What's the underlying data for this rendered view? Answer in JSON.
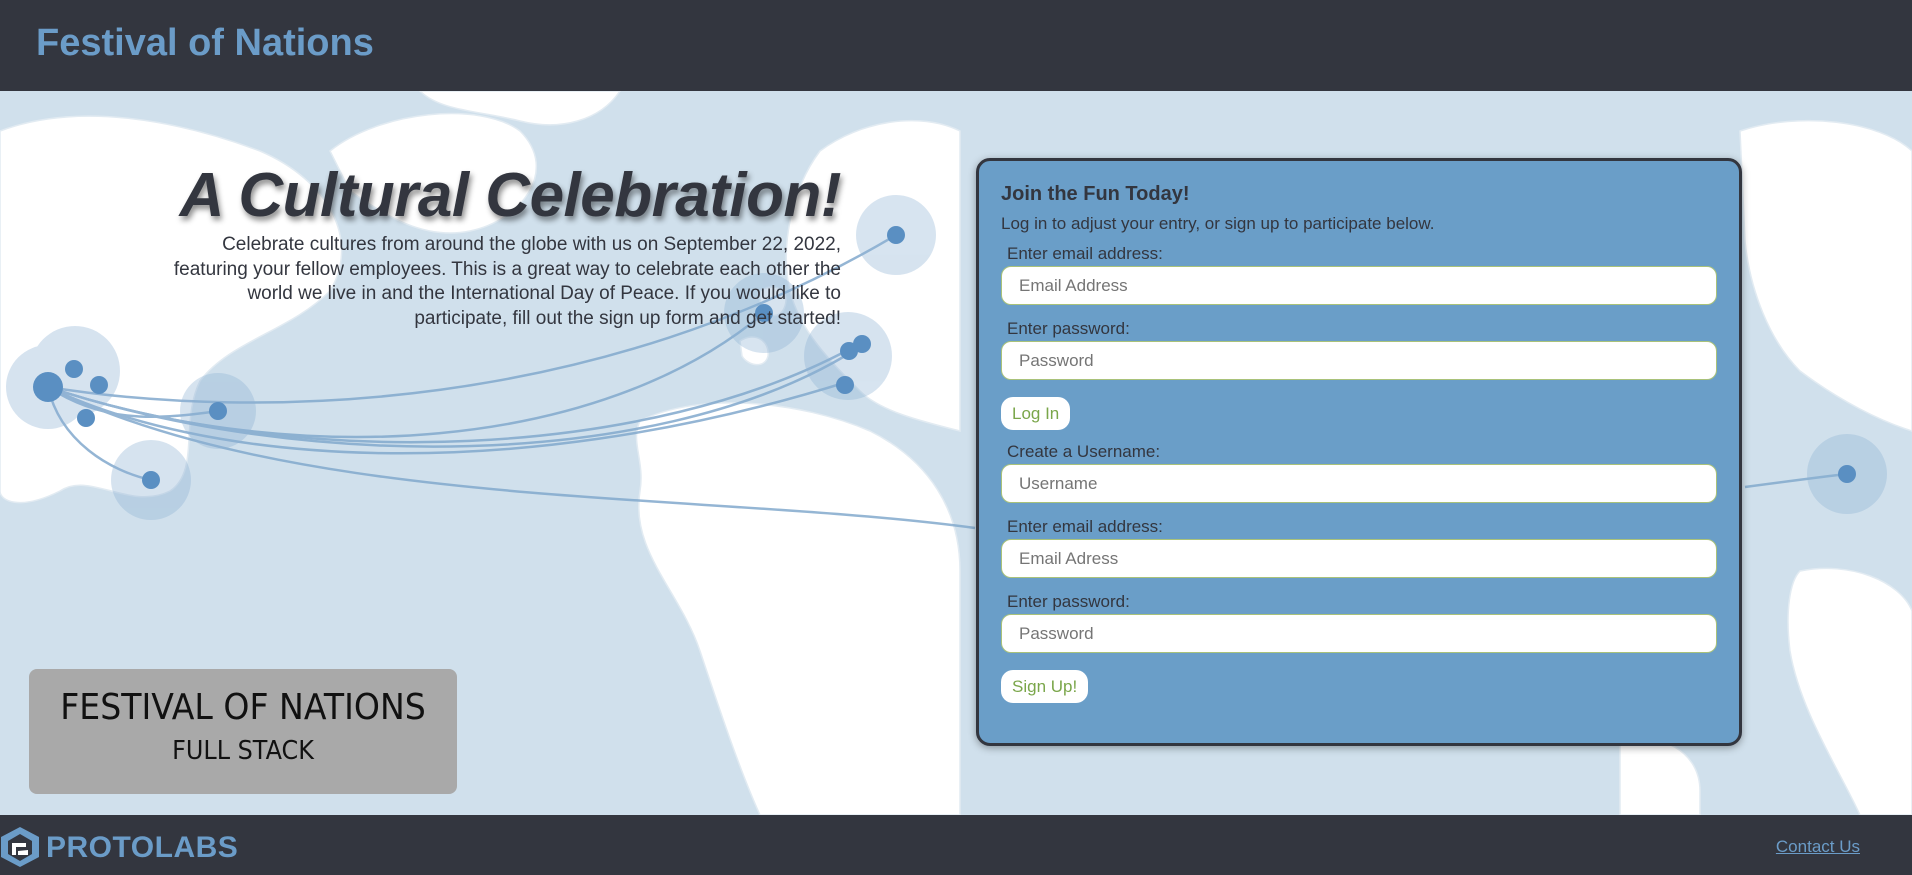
{
  "header": {
    "brand": "Festival of Nations"
  },
  "intro": {
    "title": "A Cultural Celebration!",
    "description": "Celebrate cultures from around the globe with us on September 22, 2022, featuring your fellow employees. This is a great way to celebrate each other the world we live in and the International Day of Peace. If you would like to participate, fill out the sign up form and get started!"
  },
  "form": {
    "heading": "Join the Fun Today!",
    "subheading": "Log in to adjust your entry, or sign up to participate below.",
    "login": {
      "email_label": "Enter email address:",
      "email_placeholder": "Email Address",
      "password_label": "Enter password:",
      "password_placeholder": "Password",
      "button": "Log In"
    },
    "signup": {
      "username_label": "Create a Username:",
      "username_placeholder": "Username",
      "email_label": "Enter email address:",
      "email_placeholder": "Email Adress",
      "password_label": "Enter password:",
      "password_placeholder": "Password",
      "button": "Sign Up!"
    }
  },
  "badge": {
    "line1": "FESTIVAL OF NATIONS",
    "line2": "FULL STACK"
  },
  "footer": {
    "logo_text": "PROTOLABS",
    "contact_link": "Contact Us"
  },
  "colors": {
    "header_bg": "#33363f",
    "brand_blue": "#6b9cc8",
    "form_bg": "#6a9ec8",
    "button_text": "#7aa64a",
    "map_bg": "#d0e0ec"
  }
}
